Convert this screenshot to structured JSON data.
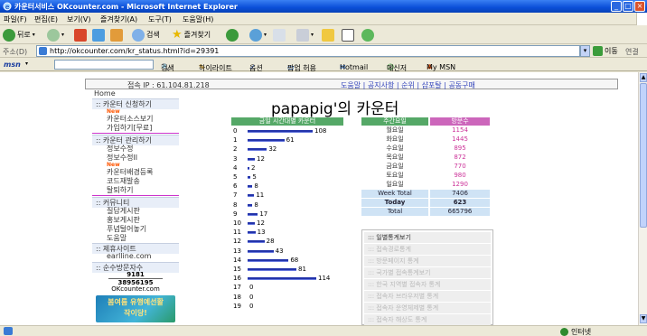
{
  "window": {
    "title": "카운터서비스 OKcounter.com - Microsoft Internet Explorer",
    "min": "_",
    "max": "□",
    "close": "×"
  },
  "menu": [
    "파일(F)",
    "편집(E)",
    "보기(V)",
    "즐겨찾기(A)",
    "도구(T)",
    "도움말(H)"
  ],
  "toolbar": {
    "back": "뒤로",
    "search": "검색",
    "favorites": "즐겨찾기"
  },
  "address": {
    "label": "주소(D)",
    "url": "http://okcounter.com/kr_status.html?id=29391",
    "go": "이동",
    "links": "연결"
  },
  "msn": {
    "logo": "msn",
    "search": "검색",
    "highlight": "하이라이트",
    "options": "옵션",
    "popup": "팝업 허용",
    "hotmail": "Hotmail",
    "messenger": "메신저",
    "mymsn": "My MSN"
  },
  "status": {
    "zone": "인터넷"
  },
  "page": {
    "ip_label": "접속 IP : 61.104.81.218",
    "topnav": "도움말 | 공지사항 | 순위 | 샵포탈 | 공동구매",
    "title": "papapig'의 카운터",
    "sidebar": {
      "home": "Home",
      "sec1": ":: 카운터 신청하기",
      "new1": "New",
      "link1": "카운터소스보기",
      "link2": "가입하기[무료]",
      "sec2": ":: 카운터 관리하기",
      "link3": "정보수정",
      "link4": "정보수정II",
      "new2": "New",
      "link5": "카운터배경등록",
      "link6": "코드재발송",
      "link7": "탈퇴하기",
      "sec3": ":: 커뮤니티",
      "link8": "질답게시판",
      "link9": "홍보게시판",
      "link10": "푸념털어놓기",
      "link11": "도움말",
      "sec4": ":: 제휴사이트",
      "link12": "earlline.com",
      "sec5": ":: 순수방문자수",
      "visits1": "9181",
      "visits2": "38956195",
      "site": "OKcounter.com",
      "banner1": "봄여름 유행예선활",
      "banner2": "작이당!"
    },
    "hourly_header": "금일 시간대별 카운터",
    "weekly": {
      "h1": "주간요일",
      "h2": "방문수",
      "days": [
        "월요일",
        "화요일",
        "수요일",
        "목요일",
        "금요일",
        "토요일",
        "일요일"
      ],
      "values": [
        "1154",
        "1445",
        "895",
        "872",
        "770",
        "980",
        "1290"
      ],
      "week_total_label": "Week Total",
      "week_total": "7406",
      "today_label": "Today",
      "today": "623",
      "total_label": "Total",
      "total": "665796"
    },
    "stat_menu": [
      "::: 일별통계보기",
      "::: 접속경로통계",
      "::: 방문페이지 통계",
      "::: 국가별 접속통계보기",
      "::: 한국 지역별 접속자 통계",
      "::: 접속자 브라우저별 통계",
      "::: 접속자 운영체제별 통계",
      "::: 접속자 해상도 통계"
    ]
  },
  "chart_data": {
    "type": "bar",
    "orientation": "horizontal",
    "title": "금일 시간대별 카운터",
    "categories": [
      "0",
      "1",
      "2",
      "3",
      "4",
      "5",
      "6",
      "7",
      "8",
      "9",
      "10",
      "11",
      "12",
      "13",
      "14",
      "15",
      "16",
      "17",
      "18",
      "19"
    ],
    "values": [
      108,
      61,
      32,
      12,
      2,
      5,
      8,
      11,
      8,
      17,
      12,
      13,
      28,
      43,
      68,
      81,
      114,
      0,
      0,
      0
    ]
  }
}
